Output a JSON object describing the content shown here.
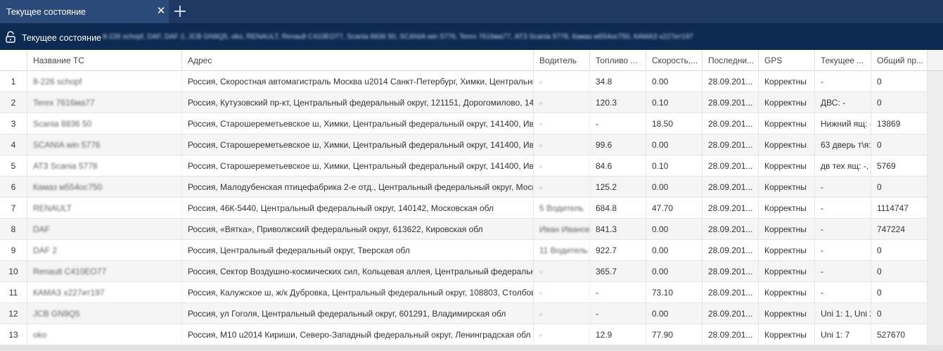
{
  "tab": {
    "title": "Текущее состояние"
  },
  "statebar": {
    "title": "Текущее состояние",
    "vehicles": "8-226 schopf, DAF, DAF 2, JCB GN9Q5, oko, RENAULT, Renault C410EO77, Scania 8836 50, SCANIA win 5776, Terex 7616ма77, АТЗ Scania 5778, Камаз м554ос750, КАМАЗ х227ит197"
  },
  "grid": {
    "headers": [
      "",
      "Название ТС",
      "Адрес",
      "Водитель",
      "Топливо ...",
      "Скорость,...",
      "Последни...",
      "GPS",
      "Текущее ...",
      "Общий пр..."
    ],
    "rows": [
      [
        "1",
        "8-226 schopf",
        "Россия, Скоростная автомагистраль Москва u2014 Санкт-Петербург, Химки, Центральный",
        "-",
        "34.8",
        "0.00",
        "28.09.201...",
        "Корректны",
        "-",
        "0"
      ],
      [
        "2",
        "Terex 7616ма77",
        "Россия, Кутузовский пр-кт, Центральный федеральный округ, 121151, Дорогомилово, 14А",
        "-",
        "120.3",
        "0.10",
        "28.09.201...",
        "Корректны",
        "ДВС: -",
        "0"
      ],
      [
        "3",
        "Scania 8836 50",
        "Россия, Старошереметьевское ш, Химки, Центральный федеральный округ, 141400, Иваки",
        "-",
        "-",
        "18.50",
        "28.09.201...",
        "Корректны",
        "Нижний ящ: -",
        "13869"
      ],
      [
        "4",
        "SCANIA win 5776",
        "Россия, Старошереметьевское ш, Химки, Центральный федеральный округ, 141400, Иваки",
        "-",
        "99.6",
        "0.00",
        "28.09.201...",
        "Корректны",
        "63 дверь т\\я:",
        "0"
      ],
      [
        "5",
        "АТЗ Scania 5778",
        "Россия, Старошереметьевское ш, Химки, Центральный федеральный округ, 141400, Иваки",
        "-",
        "84.6",
        "0.10",
        "28.09.201...",
        "Корректны",
        "дв тех ящ: -, д",
        "5769"
      ],
      [
        "6",
        "Камаз м554ос750",
        "Россия, Малодубенская птицефабрика 2-е отд., Центральный федеральный округ, Москове",
        "-",
        "125.2",
        "0.00",
        "28.09.201...",
        "Корректны",
        "-",
        "0"
      ],
      [
        "7",
        "RENAULT",
        "Россия, 46К-5440, Центральный федеральный округ, 140142, Московская обл",
        "5 Водитель",
        "684.8",
        "47.70",
        "28.09.201...",
        "Корректны",
        "-",
        "1114747"
      ],
      [
        "8",
        "DAF",
        "Россия, «Вятка», Приволжский федеральный округ, 613622, Кировская обл",
        "Иван Иванов",
        "841.3",
        "0.00",
        "28.09.201...",
        "Корректны",
        "-",
        "747224"
      ],
      [
        "9",
        "DAF 2",
        "Россия, Центральный федеральный округ, Тверская обл",
        "11 Водитель",
        "922.7",
        "0.00",
        "28.09.201...",
        "Корректны",
        "-",
        "0"
      ],
      [
        "10",
        "Renault C410EO77",
        "Россия, Сектор Воздушно-космических сил, Кольцевая аллея, Центральный федеральный",
        "-",
        "365.7",
        "0.00",
        "28.09.201...",
        "Корректны",
        "-",
        "0"
      ],
      [
        "11",
        "КАМАЗ х227ит197",
        "Россия, Калужское ш, ж/к Дубровка, Центральный федеральный округ, 108803, Столбово,",
        "-",
        "-",
        "73.10",
        "28.09.201...",
        "Корректны",
        "-",
        "0"
      ],
      [
        "12",
        "JCB GN9Q5",
        "Россия, ул Гоголя, Центральный федеральный округ, 601291, Владимирская обл",
        "-",
        "-",
        "0.00",
        "28.09.201...",
        "Корректны",
        "Uni 1: 1, Uni 2:",
        "0"
      ],
      [
        "13",
        "oko",
        "Россия, М10 u2014 Кириши, Северо-Западный федеральный округ, Ленинградская обл",
        "-",
        "12.9",
        "77.90",
        "28.09.201...",
        "Корректны",
        "Uni 1: 7",
        "527670"
      ]
    ]
  },
  "icons": {
    "close": "close-icon",
    "add": "plus-icon",
    "lock": "unlock-icon"
  },
  "colors": {
    "tabbar": "#1e3a63",
    "statebar": "#0c2a52",
    "active_tab": "#2a4a7a"
  }
}
